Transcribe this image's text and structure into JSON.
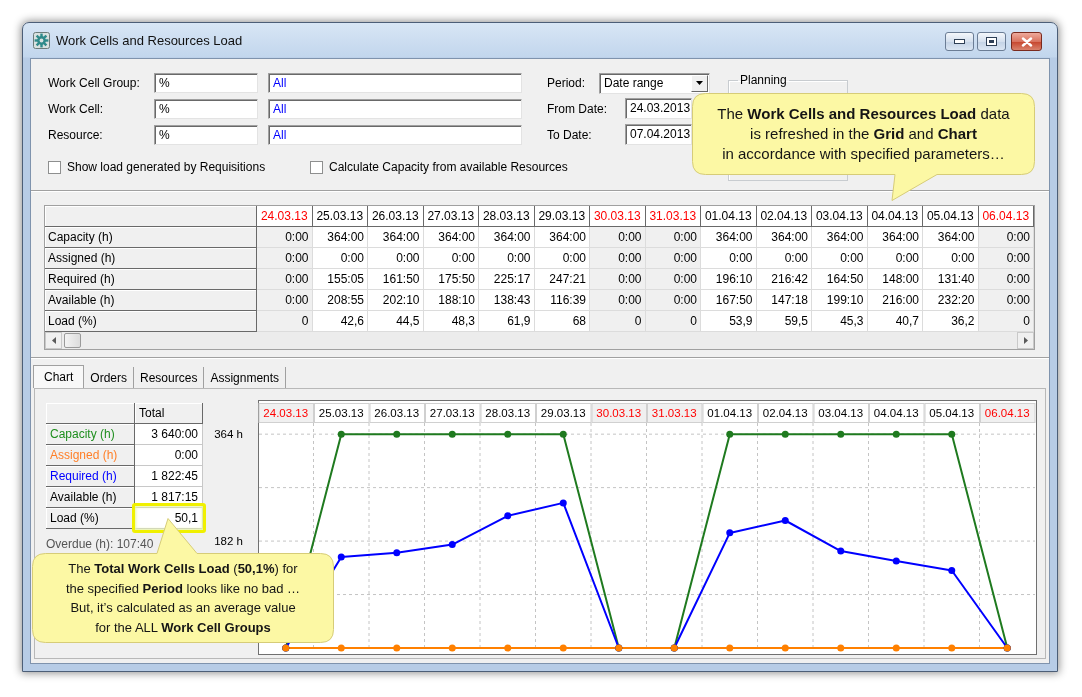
{
  "window": {
    "title": "Work Cells and Resources Load"
  },
  "filters": {
    "fields": [
      {
        "label": "Work Cell Group:",
        "code": "%",
        "name": "All"
      },
      {
        "label": "Work Cell:",
        "code": "%",
        "name": "All"
      },
      {
        "label": "Resource:",
        "code": "%",
        "name": "All"
      }
    ],
    "checkboxes": [
      {
        "label": "Show load generated by Requisitions",
        "checked": false
      },
      {
        "label": "Calculate Capacity from available Resources",
        "checked": false
      }
    ]
  },
  "period": {
    "label": "Period:",
    "value": "Date range"
  },
  "dates": [
    {
      "label": "From Date:",
      "value": "24.03.2013"
    },
    {
      "label": "To Date:",
      "value": "07.04.2013"
    }
  ],
  "planning": {
    "title": "Planning"
  },
  "grid": {
    "columns": [
      {
        "label": "24.03.13",
        "weekend": true
      },
      {
        "label": "25.03.13",
        "weekend": false
      },
      {
        "label": "26.03.13",
        "weekend": false
      },
      {
        "label": "27.03.13",
        "weekend": false
      },
      {
        "label": "28.03.13",
        "weekend": false
      },
      {
        "label": "29.03.13",
        "weekend": false
      },
      {
        "label": "30.03.13",
        "weekend": true
      },
      {
        "label": "31.03.13",
        "weekend": true
      },
      {
        "label": "01.04.13",
        "weekend": false
      },
      {
        "label": "02.04.13",
        "weekend": false
      },
      {
        "label": "03.04.13",
        "weekend": false
      },
      {
        "label": "04.04.13",
        "weekend": false
      },
      {
        "label": "05.04.13",
        "weekend": false
      },
      {
        "label": "06.04.13",
        "weekend": true
      }
    ],
    "rows": [
      {
        "label": "Capacity (h)",
        "values": [
          "0:00",
          "364:00",
          "364:00",
          "364:00",
          "364:00",
          "364:00",
          "0:00",
          "0:00",
          "364:00",
          "364:00",
          "364:00",
          "364:00",
          "364:00",
          "0:00"
        ]
      },
      {
        "label": "Assigned (h)",
        "values": [
          "0:00",
          "0:00",
          "0:00",
          "0:00",
          "0:00",
          "0:00",
          "0:00",
          "0:00",
          "0:00",
          "0:00",
          "0:00",
          "0:00",
          "0:00",
          "0:00"
        ]
      },
      {
        "label": "Required (h)",
        "values": [
          "0:00",
          "155:05",
          "161:50",
          "175:50",
          "225:17",
          "247:21",
          "0:00",
          "0:00",
          "196:10",
          "216:42",
          "164:50",
          "148:00",
          "131:40",
          "0:00"
        ]
      },
      {
        "label": "Available (h)",
        "values": [
          "0:00",
          "208:55",
          "202:10",
          "188:10",
          "138:43",
          "116:39",
          "0:00",
          "0:00",
          "167:50",
          "147:18",
          "199:10",
          "216:00",
          "232:20",
          "0:00"
        ]
      },
      {
        "label": "Load (%)",
        "values": [
          "0",
          "42,6",
          "44,5",
          "48,3",
          "61,9",
          "68",
          "0",
          "0",
          "53,9",
          "59,5",
          "45,3",
          "40,7",
          "36,2",
          "0"
        ]
      }
    ]
  },
  "tabs": [
    {
      "label": "Chart",
      "selected": true
    },
    {
      "label": "Orders",
      "selected": false
    },
    {
      "label": "Resources",
      "selected": false
    },
    {
      "label": "Assignments",
      "selected": false
    }
  ],
  "summary": {
    "header": "Total",
    "rows": [
      {
        "label": "Capacity (h)",
        "value": "3 640:00",
        "color": "#1f8f1f",
        "highlighted": false
      },
      {
        "label": "Assigned (h)",
        "value": "0:00",
        "color": "#ff7f27",
        "highlighted": false
      },
      {
        "label": "Required (h)",
        "value": "1 822:45",
        "color": "#0000ff",
        "highlighted": false
      },
      {
        "label": "Available (h)",
        "value": "1 817:15",
        "color": "#000000",
        "highlighted": false
      },
      {
        "label": "Load (%)",
        "value": "50,1",
        "color": "#000000",
        "highlighted": true
      }
    ],
    "overdue": "Overdue (h): 107:40"
  },
  "chart": {
    "chart_data": {
      "type": "line",
      "categories": [
        "24.03.13",
        "25.03.13",
        "26.03.13",
        "27.03.13",
        "28.03.13",
        "29.03.13",
        "30.03.13",
        "31.03.13",
        "01.04.13",
        "02.04.13",
        "03.04.13",
        "04.04.13",
        "05.04.13",
        "06.04.13"
      ],
      "series": [
        {
          "color": "#1f7a1f",
          "marker": "circle",
          "values": [
            0,
            364,
            364,
            364,
            364,
            364,
            0,
            0,
            364,
            364,
            364,
            364,
            364,
            0
          ]
        },
        {
          "color": "#0000ff",
          "marker": "circle",
          "values": [
            0,
            155,
            162,
            176,
            225,
            247,
            0,
            0,
            196,
            217,
            165,
            148,
            132,
            0
          ]
        },
        {
          "color": "#ff8000",
          "marker": "circle",
          "values": [
            0,
            0,
            0,
            0,
            0,
            0,
            0,
            0,
            0,
            0,
            0,
            0,
            0,
            0
          ]
        }
      ],
      "ylim": [
        0,
        383
      ],
      "yticks": [
        {
          "value": 182,
          "label": "182 h"
        },
        {
          "value": 364,
          "label": "364 h"
        }
      ]
    }
  },
  "callouts": [
    {
      "text": "The **Work Cells and Resources Load** data\nis refreshed in the **Grid** and **Chart**\nin accordance with specified parameters…"
    },
    {
      "text": "The **Total Work Cells Load** (**50,1%**) for\nthe specified **Period** looks like no bad …\nBut, it’s calculated as an average value\nfor the ALL **Work Cell Groups**"
    }
  ]
}
